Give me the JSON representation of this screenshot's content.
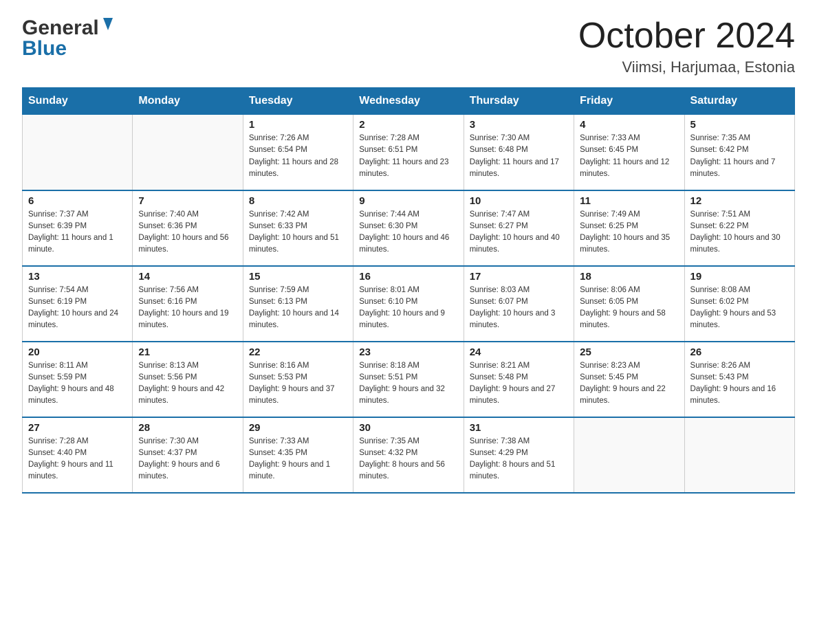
{
  "header": {
    "logo_general": "General",
    "logo_blue": "Blue",
    "month_title": "October 2024",
    "location": "Viimsi, Harjumaa, Estonia"
  },
  "days_of_week": [
    "Sunday",
    "Monday",
    "Tuesday",
    "Wednesday",
    "Thursday",
    "Friday",
    "Saturday"
  ],
  "weeks": [
    [
      {
        "day": "",
        "sunrise": "",
        "sunset": "",
        "daylight": ""
      },
      {
        "day": "",
        "sunrise": "",
        "sunset": "",
        "daylight": ""
      },
      {
        "day": "1",
        "sunrise": "Sunrise: 7:26 AM",
        "sunset": "Sunset: 6:54 PM",
        "daylight": "Daylight: 11 hours and 28 minutes."
      },
      {
        "day": "2",
        "sunrise": "Sunrise: 7:28 AM",
        "sunset": "Sunset: 6:51 PM",
        "daylight": "Daylight: 11 hours and 23 minutes."
      },
      {
        "day": "3",
        "sunrise": "Sunrise: 7:30 AM",
        "sunset": "Sunset: 6:48 PM",
        "daylight": "Daylight: 11 hours and 17 minutes."
      },
      {
        "day": "4",
        "sunrise": "Sunrise: 7:33 AM",
        "sunset": "Sunset: 6:45 PM",
        "daylight": "Daylight: 11 hours and 12 minutes."
      },
      {
        "day": "5",
        "sunrise": "Sunrise: 7:35 AM",
        "sunset": "Sunset: 6:42 PM",
        "daylight": "Daylight: 11 hours and 7 minutes."
      }
    ],
    [
      {
        "day": "6",
        "sunrise": "Sunrise: 7:37 AM",
        "sunset": "Sunset: 6:39 PM",
        "daylight": "Daylight: 11 hours and 1 minute."
      },
      {
        "day": "7",
        "sunrise": "Sunrise: 7:40 AM",
        "sunset": "Sunset: 6:36 PM",
        "daylight": "Daylight: 10 hours and 56 minutes."
      },
      {
        "day": "8",
        "sunrise": "Sunrise: 7:42 AM",
        "sunset": "Sunset: 6:33 PM",
        "daylight": "Daylight: 10 hours and 51 minutes."
      },
      {
        "day": "9",
        "sunrise": "Sunrise: 7:44 AM",
        "sunset": "Sunset: 6:30 PM",
        "daylight": "Daylight: 10 hours and 46 minutes."
      },
      {
        "day": "10",
        "sunrise": "Sunrise: 7:47 AM",
        "sunset": "Sunset: 6:27 PM",
        "daylight": "Daylight: 10 hours and 40 minutes."
      },
      {
        "day": "11",
        "sunrise": "Sunrise: 7:49 AM",
        "sunset": "Sunset: 6:25 PM",
        "daylight": "Daylight: 10 hours and 35 minutes."
      },
      {
        "day": "12",
        "sunrise": "Sunrise: 7:51 AM",
        "sunset": "Sunset: 6:22 PM",
        "daylight": "Daylight: 10 hours and 30 minutes."
      }
    ],
    [
      {
        "day": "13",
        "sunrise": "Sunrise: 7:54 AM",
        "sunset": "Sunset: 6:19 PM",
        "daylight": "Daylight: 10 hours and 24 minutes."
      },
      {
        "day": "14",
        "sunrise": "Sunrise: 7:56 AM",
        "sunset": "Sunset: 6:16 PM",
        "daylight": "Daylight: 10 hours and 19 minutes."
      },
      {
        "day": "15",
        "sunrise": "Sunrise: 7:59 AM",
        "sunset": "Sunset: 6:13 PM",
        "daylight": "Daylight: 10 hours and 14 minutes."
      },
      {
        "day": "16",
        "sunrise": "Sunrise: 8:01 AM",
        "sunset": "Sunset: 6:10 PM",
        "daylight": "Daylight: 10 hours and 9 minutes."
      },
      {
        "day": "17",
        "sunrise": "Sunrise: 8:03 AM",
        "sunset": "Sunset: 6:07 PM",
        "daylight": "Daylight: 10 hours and 3 minutes."
      },
      {
        "day": "18",
        "sunrise": "Sunrise: 8:06 AM",
        "sunset": "Sunset: 6:05 PM",
        "daylight": "Daylight: 9 hours and 58 minutes."
      },
      {
        "day": "19",
        "sunrise": "Sunrise: 8:08 AM",
        "sunset": "Sunset: 6:02 PM",
        "daylight": "Daylight: 9 hours and 53 minutes."
      }
    ],
    [
      {
        "day": "20",
        "sunrise": "Sunrise: 8:11 AM",
        "sunset": "Sunset: 5:59 PM",
        "daylight": "Daylight: 9 hours and 48 minutes."
      },
      {
        "day": "21",
        "sunrise": "Sunrise: 8:13 AM",
        "sunset": "Sunset: 5:56 PM",
        "daylight": "Daylight: 9 hours and 42 minutes."
      },
      {
        "day": "22",
        "sunrise": "Sunrise: 8:16 AM",
        "sunset": "Sunset: 5:53 PM",
        "daylight": "Daylight: 9 hours and 37 minutes."
      },
      {
        "day": "23",
        "sunrise": "Sunrise: 8:18 AM",
        "sunset": "Sunset: 5:51 PM",
        "daylight": "Daylight: 9 hours and 32 minutes."
      },
      {
        "day": "24",
        "sunrise": "Sunrise: 8:21 AM",
        "sunset": "Sunset: 5:48 PM",
        "daylight": "Daylight: 9 hours and 27 minutes."
      },
      {
        "day": "25",
        "sunrise": "Sunrise: 8:23 AM",
        "sunset": "Sunset: 5:45 PM",
        "daylight": "Daylight: 9 hours and 22 minutes."
      },
      {
        "day": "26",
        "sunrise": "Sunrise: 8:26 AM",
        "sunset": "Sunset: 5:43 PM",
        "daylight": "Daylight: 9 hours and 16 minutes."
      }
    ],
    [
      {
        "day": "27",
        "sunrise": "Sunrise: 7:28 AM",
        "sunset": "Sunset: 4:40 PM",
        "daylight": "Daylight: 9 hours and 11 minutes."
      },
      {
        "day": "28",
        "sunrise": "Sunrise: 7:30 AM",
        "sunset": "Sunset: 4:37 PM",
        "daylight": "Daylight: 9 hours and 6 minutes."
      },
      {
        "day": "29",
        "sunrise": "Sunrise: 7:33 AM",
        "sunset": "Sunset: 4:35 PM",
        "daylight": "Daylight: 9 hours and 1 minute."
      },
      {
        "day": "30",
        "sunrise": "Sunrise: 7:35 AM",
        "sunset": "Sunset: 4:32 PM",
        "daylight": "Daylight: 8 hours and 56 minutes."
      },
      {
        "day": "31",
        "sunrise": "Sunrise: 7:38 AM",
        "sunset": "Sunset: 4:29 PM",
        "daylight": "Daylight: 8 hours and 51 minutes."
      },
      {
        "day": "",
        "sunrise": "",
        "sunset": "",
        "daylight": ""
      },
      {
        "day": "",
        "sunrise": "",
        "sunset": "",
        "daylight": ""
      }
    ]
  ]
}
